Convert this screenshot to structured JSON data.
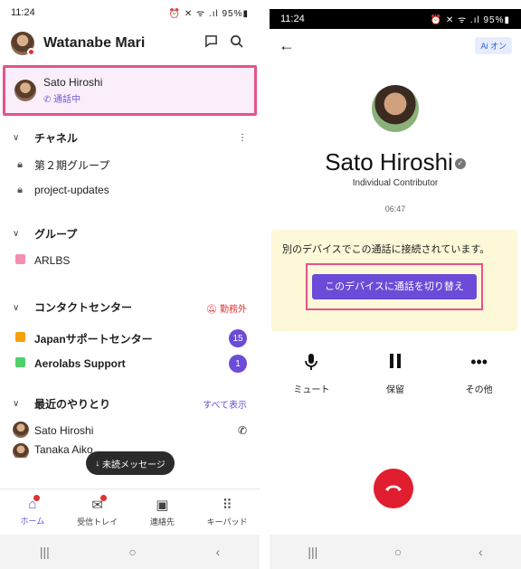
{
  "left": {
    "status": {
      "time": "11:24",
      "icons": "⏰ ✕ ᯤ .ıl 95%▮"
    },
    "header": {
      "name": "Watanabe Mari"
    },
    "active_call": {
      "name": "Sato Hiroshi",
      "status": "通話中"
    },
    "channels": {
      "title": "チャネル",
      "items": [
        {
          "label": "第２期グループ"
        },
        {
          "label": "project-updates"
        }
      ]
    },
    "groups": {
      "title": "グループ",
      "items": [
        {
          "label": "ARLBS",
          "color": "#f48fb1"
        }
      ]
    },
    "contact_center": {
      "title": "コンタクトセンター",
      "status": "勤務外",
      "status_color": "#e03131",
      "items": [
        {
          "label": "Japanサポートセンター",
          "badge": "15",
          "color": "#f6a10a"
        },
        {
          "label": "Aerolabs Support",
          "badge": "1",
          "color": "#4cd16b"
        }
      ]
    },
    "recent": {
      "title": "最近のやりとり",
      "show_all": "すべて表示",
      "items": [
        {
          "label": "Sato Hiroshi"
        },
        {
          "label": "Tanaka Aiko"
        }
      ]
    },
    "toast": "未読メッセージ",
    "tabs": [
      {
        "label": "ホーム",
        "icon": "home-icon"
      },
      {
        "label": "受信トレイ",
        "icon": "inbox-icon"
      },
      {
        "label": "連絡先",
        "icon": "contacts-icon"
      },
      {
        "label": "キーパッド",
        "icon": "keypad-icon"
      }
    ]
  },
  "right": {
    "status": {
      "time": "11:24",
      "icons": "⏰ ✕ ᯤ .ıl 95%▮"
    },
    "ai_toggle": "Ai オン",
    "caller": {
      "name": "Sato Hiroshi",
      "role": "Individual Contributor"
    },
    "timer": "06:47",
    "notice": "別のデバイスでこの通話に接続されています。",
    "switch_button": "このデバイスに通話を切り替え",
    "actions": [
      {
        "label": "ミュート",
        "icon": "microphone-icon"
      },
      {
        "label": "保留",
        "icon": "pause-icon"
      },
      {
        "label": "その他",
        "icon": "more-icon"
      }
    ],
    "accent": "#6c4bd8",
    "hangup_color": "#e01e2f"
  }
}
